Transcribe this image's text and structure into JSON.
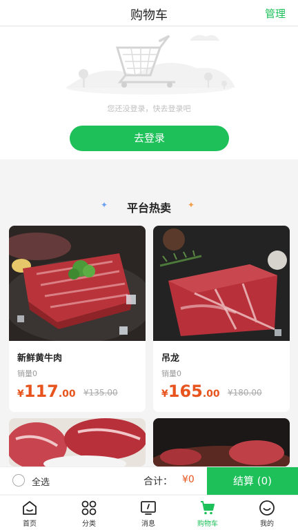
{
  "header": {
    "title": "购物车",
    "manage": "管理"
  },
  "empty": {
    "tip": "您还没登录，快去登录吧",
    "login_button": "去登录"
  },
  "hot": {
    "title": "平台热卖"
  },
  "products": [
    {
      "name": "新鲜黄牛肉",
      "sales": "销量0",
      "currency": "¥",
      "price_int": "117",
      "price_dec": ".00",
      "old_price": "¥135.00"
    },
    {
      "name": "吊龙",
      "sales": "销量0",
      "currency": "¥",
      "price_int": "165",
      "price_dec": ".00",
      "old_price": "¥180.00"
    }
  ],
  "checkout": {
    "select_all": "全选",
    "total_label": "合计：",
    "total_value": "¥0",
    "pay_button": "结算 (0)"
  },
  "tabs": [
    {
      "label": "首页",
      "icon": "home-icon"
    },
    {
      "label": "分类",
      "icon": "category-icon"
    },
    {
      "label": "消息",
      "icon": "message-icon"
    },
    {
      "label": "购物车",
      "icon": "cart-icon"
    },
    {
      "label": "我的",
      "icon": "profile-icon"
    }
  ],
  "colors": {
    "accent": "#1ec05a",
    "price": "#e8541e"
  }
}
